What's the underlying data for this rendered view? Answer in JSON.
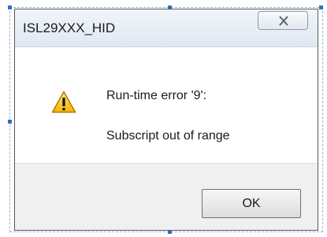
{
  "window": {
    "title": "ISL29XXX_HID",
    "close_icon": "close-icon"
  },
  "message": {
    "icon": "warning-icon",
    "line1": "Run-time error '9':",
    "line2": "Subscript out of range"
  },
  "buttons": {
    "ok_label": "OK"
  },
  "colors": {
    "warning_fill": "#f5c400",
    "warning_border": "#b07a00",
    "frame_handle": "#2f6fbf"
  }
}
